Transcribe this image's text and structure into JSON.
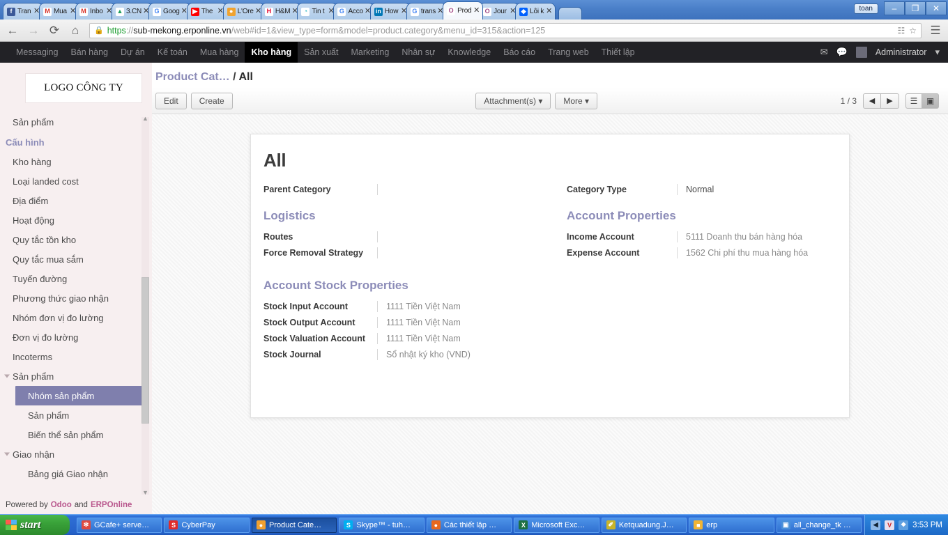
{
  "browser": {
    "tabs": [
      {
        "label": "Tran",
        "icon": "facebook-icon",
        "icon_glyph": "f",
        "icon_color": "#3b5998",
        "active": false
      },
      {
        "label": "Mua",
        "icon": "gmail-icon",
        "icon_glyph": "M",
        "icon_color": "#ffffff",
        "fg": "#d93025",
        "active": false
      },
      {
        "label": "Inbo",
        "icon": "gmail-icon",
        "icon_glyph": "M",
        "icon_color": "#ffffff",
        "fg": "#d93025",
        "active": false
      },
      {
        "label": "3.CN",
        "icon": "google-drive-icon",
        "icon_glyph": "▲",
        "icon_color": "#ffffff",
        "fg": "#1a9c5a",
        "active": false
      },
      {
        "label": "Goog",
        "icon": "google-icon",
        "icon_glyph": "G",
        "icon_color": "#ffffff",
        "fg": "#4285f4",
        "active": false
      },
      {
        "label": "The",
        "icon": "youtube-icon",
        "icon_glyph": "▶",
        "icon_color": "#ff0000",
        "active": false
      },
      {
        "label": "L'Ore",
        "icon": "circle-icon",
        "icon_glyph": "●",
        "icon_color": "#f0a330",
        "active": false
      },
      {
        "label": "H&M",
        "icon": "hm-icon",
        "icon_glyph": "H",
        "icon_color": "#ffffff",
        "fg": "#e4002b",
        "active": false
      },
      {
        "label": "Tin t",
        "icon": "clock-icon",
        "icon_glyph": "◔",
        "icon_color": "#ffffff",
        "fg": "#24b3c4",
        "active": false
      },
      {
        "label": "Acco",
        "icon": "google-icon",
        "icon_glyph": "G",
        "icon_color": "#ffffff",
        "fg": "#4285f4",
        "active": false
      },
      {
        "label": "How",
        "icon": "linkedin-icon",
        "icon_glyph": "in",
        "icon_color": "#0077b5",
        "active": false
      },
      {
        "label": "trans",
        "icon": "google-icon",
        "icon_glyph": "G",
        "icon_color": "#ffffff",
        "fg": "#4285f4",
        "active": false
      },
      {
        "label": "Prod",
        "icon": "odoo-icon",
        "icon_glyph": "O",
        "icon_color": "#ffffff",
        "fg": "#a24b87",
        "active": true
      },
      {
        "label": "Jour",
        "icon": "odoo-icon",
        "icon_glyph": "O",
        "icon_color": "#ffffff",
        "fg": "#a24b87",
        "active": false
      },
      {
        "label": "Lỗi k",
        "icon": "dropbox-icon",
        "icon_glyph": "◆",
        "icon_color": "#0061fe",
        "active": false
      }
    ],
    "new_tab_label": "",
    "window_user": "toan",
    "window_buttons": [
      "–",
      "❐",
      "✕"
    ],
    "nav": {
      "back": "←",
      "forward": "→",
      "reload": "⟳",
      "home": "⌂"
    },
    "omnibox": {
      "lock": "🔒",
      "scheme": "https",
      "separator": "://",
      "host": "sub-mekong.erponline.vn",
      "path": "/web#id=1&view_type=form&model=product.category&menu_id=315&action=125",
      "translate_icon": "translate-icon",
      "star_icon": "☆",
      "menu_icon": "☰"
    }
  },
  "odoo": {
    "top_menu": [
      {
        "label": "Messaging",
        "active": false
      },
      {
        "label": "Bán hàng",
        "active": false
      },
      {
        "label": "Dự án",
        "active": false
      },
      {
        "label": "Kế toán",
        "active": false
      },
      {
        "label": "Mua hàng",
        "active": false
      },
      {
        "label": "Kho hàng",
        "active": true
      },
      {
        "label": "Sản xuất",
        "active": false
      },
      {
        "label": "Marketing",
        "active": false
      },
      {
        "label": "Nhân sự",
        "active": false
      },
      {
        "label": "Knowledge",
        "active": false
      },
      {
        "label": "Báo cáo",
        "active": false
      },
      {
        "label": "Trang web",
        "active": false
      },
      {
        "label": "Thiết lập",
        "active": false
      }
    ],
    "top_right": {
      "mail_icon": "✉",
      "chat_icon": "●",
      "user_name": "Administrator",
      "caret": "▾"
    },
    "sidebar": {
      "logo_text": "LOGO CÔNG TY",
      "items": [
        {
          "label": "Sản phẩm",
          "type": "item"
        },
        {
          "label": "Cấu hình",
          "type": "section"
        },
        {
          "label": "Kho hàng",
          "type": "item"
        },
        {
          "label": "Loại landed cost",
          "type": "item"
        },
        {
          "label": "Địa điểm",
          "type": "item"
        },
        {
          "label": "Hoạt động",
          "type": "item"
        },
        {
          "label": "Quy tắc tồn kho",
          "type": "item"
        },
        {
          "label": "Quy tắc mua sắm",
          "type": "item"
        },
        {
          "label": "Tuyến đường",
          "type": "item"
        },
        {
          "label": "Phương thức giao nhận",
          "type": "item"
        },
        {
          "label": "Nhóm đơn vị đo lường",
          "type": "item"
        },
        {
          "label": "Đơn vị đo lường",
          "type": "item"
        },
        {
          "label": "Incoterms",
          "type": "item"
        },
        {
          "label": "Sản phẩm",
          "type": "parent"
        },
        {
          "label": "Nhóm sản phẩm",
          "type": "sub",
          "selected": true
        },
        {
          "label": "Sản phẩm",
          "type": "sub"
        },
        {
          "label": "Biến thể sản phẩm",
          "type": "sub"
        },
        {
          "label": "Giao nhận",
          "type": "parent"
        },
        {
          "label": "Bảng giá Giao nhận",
          "type": "sub"
        }
      ],
      "footer": {
        "prefix": "Powered by",
        "brand1": "Odoo",
        "middle": "and",
        "brand2": "ERPOnline"
      }
    },
    "breadcrumb": {
      "parent": "Product Cat…",
      "separator": "/",
      "current": "All"
    },
    "toolbar": {
      "edit_label": "Edit",
      "create_label": "Create",
      "attachments_label": "Attachment(s)",
      "more_label": "More",
      "caret": "▾",
      "pager": "1 / 3",
      "prev_icon": "◀",
      "next_icon": "▶",
      "list_view_icon": "☰",
      "form_view_icon": "▣"
    },
    "form": {
      "record_title": "All",
      "left": {
        "parent_category_label": "Parent Category",
        "parent_category_value": "",
        "logistics_title": "Logistics",
        "routes_label": "Routes",
        "routes_value": "",
        "force_removal_label": "Force Removal Strategy",
        "force_removal_value": "",
        "stock_props_title": "Account Stock Properties",
        "stock_input_label": "Stock Input Account",
        "stock_input_value": "1111 Tiền Việt Nam",
        "stock_output_label": "Stock Output Account",
        "stock_output_value": "1111 Tiền Việt Nam",
        "stock_valuation_label": "Stock Valuation Account",
        "stock_valuation_value": "1111 Tiền Việt Nam",
        "stock_journal_label": "Stock Journal",
        "stock_journal_value": "Sổ nhật ký kho (VND)"
      },
      "right": {
        "category_type_label": "Category Type",
        "category_type_value": "Normal",
        "account_props_title": "Account Properties",
        "income_account_label": "Income Account",
        "income_account_value": "5111 Doanh thu bán hàng hóa",
        "expense_account_label": "Expense Account",
        "expense_account_value": "1562 Chi phí thu mua hàng hóa"
      }
    }
  },
  "taskbar": {
    "start_label": "start",
    "tasks": [
      {
        "label": "GCafe+ serve…",
        "icon_glyph": "✻",
        "icon_color": "#e04a3f",
        "active": false
      },
      {
        "label": "CyberPay",
        "icon_glyph": "S",
        "icon_color": "#e02c2c",
        "active": false
      },
      {
        "label": "Product Cate…",
        "icon_glyph": "●",
        "icon_color": "#f0a030",
        "active": true
      },
      {
        "label": "Skype™ - tuh…",
        "icon_glyph": "S",
        "icon_color": "#00aff0",
        "active": false
      },
      {
        "label": "Các thiết lập …",
        "icon_glyph": "●",
        "icon_color": "#e8681f",
        "active": false
      },
      {
        "label": "Microsoft Exc…",
        "icon_glyph": "X",
        "icon_color": "#1d7044",
        "active": false
      },
      {
        "label": "Ketquadung.J…",
        "icon_glyph": "✐",
        "icon_color": "#c8b42a",
        "active": false
      },
      {
        "label": "erp",
        "icon_glyph": "■",
        "icon_color": "#f0b434",
        "active": false
      },
      {
        "label": "all_change_tk …",
        "icon_glyph": "▣",
        "icon_color": "#4a90d9",
        "active": false
      }
    ],
    "tray": {
      "show_hidden_icon": "◀",
      "antivirus_icon": "V",
      "network_icon": "❖",
      "clock": "3:53 PM"
    }
  },
  "colors": {
    "accent_purple": "#8c8cb8",
    "sidebar_bg": "#f7eff0",
    "selected_item": "#7f7fad",
    "brand_pink": "#b9578d",
    "odoo_topbar": "#222226"
  }
}
